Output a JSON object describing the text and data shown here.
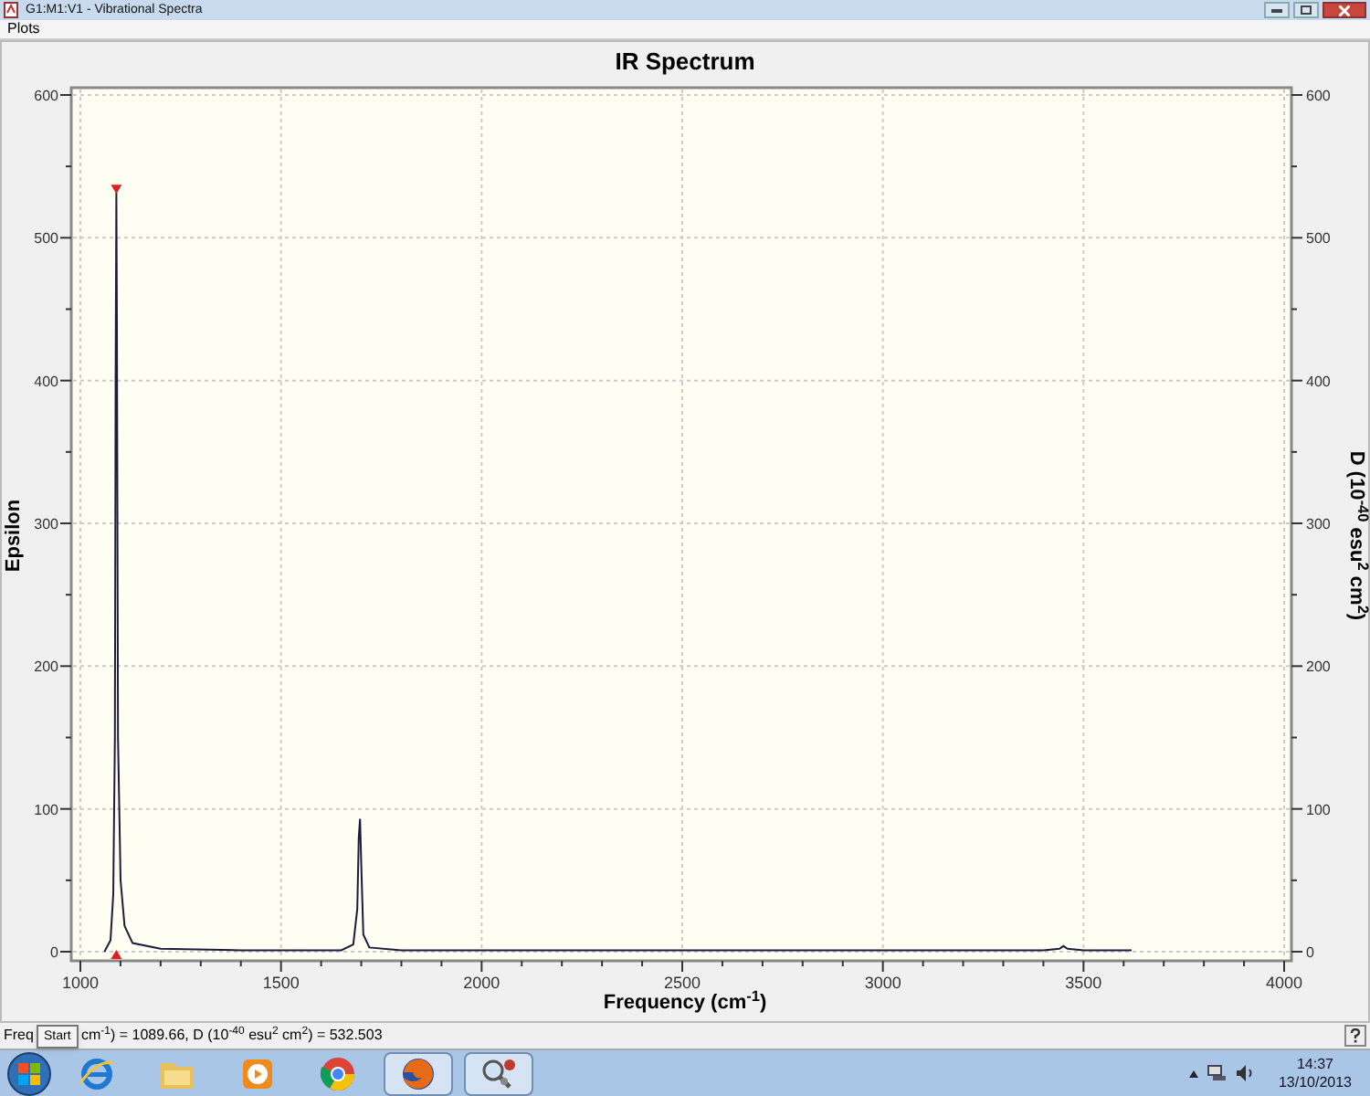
{
  "window": {
    "title": "G1:M1:V1 - Vibrational Spectra"
  },
  "menu": [
    {
      "label": "Plots"
    }
  ],
  "plot": {
    "chart_data": {
      "type": "line",
      "title": "IR Spectrum",
      "xlabel": "Frequency (cm$^{-1}$)",
      "ylabel": "Epsilon",
      "x": [
        1060,
        1075,
        1082,
        1086,
        1088,
        1089.66,
        1091,
        1094,
        1100,
        1110,
        1130,
        1200,
        1400,
        1650,
        1680,
        1690,
        1694,
        1697,
        1700,
        1705,
        1720,
        1800,
        2500,
        3000,
        3400,
        3440,
        3450,
        3460,
        3500,
        3620
      ],
      "series": [
        {
          "color": "#1c1c3c",
          "values": [
            0,
            8,
            40,
            150,
            400,
            532,
            440,
            150,
            50,
            18,
            6,
            2,
            1,
            1,
            5,
            30,
            80,
            93,
            60,
            12,
            3,
            1,
            1,
            1,
            1,
            2,
            4,
            2,
            1,
            1
          ]
        }
      ],
      "xlim": [
        1000,
        4000
      ],
      "ylim": [
        0,
        600
      ],
      "xticks": [
        1000,
        1500,
        2000,
        2500,
        3000,
        3500,
        4000
      ],
      "yticks": [
        600,
        500,
        400,
        300,
        200,
        100,
        0
      ],
      "grid": true
    },
    "right_axis": {
      "label": "D (10$^{-40}$ esu$^{2}$ cm$^{2}$)",
      "ticks": [
        "600",
        "500",
        "400",
        "300",
        "200",
        "100",
        "0"
      ]
    }
  },
  "status_bar": {
    "text_start": "Freq",
    "text_end": "cm$^{-1}$) = 1089.66, D (10$^{-40}$ esu$^{2}$ cm$^{2}$) = 532.503",
    "tooltip": "Start"
  },
  "taskbar": {
    "apps": [
      {
        "kind": "explorer",
        "selected": false
      },
      {
        "kind": "folder",
        "selected": false
      },
      {
        "kind": "media",
        "selected": false
      },
      {
        "kind": "chrome",
        "selected": false
      },
      {
        "kind": "firefox",
        "selected": true
      },
      {
        "kind": "viewer",
        "selected": true
      }
    ],
    "time": "14:37",
    "date": "13/10/2013"
  }
}
